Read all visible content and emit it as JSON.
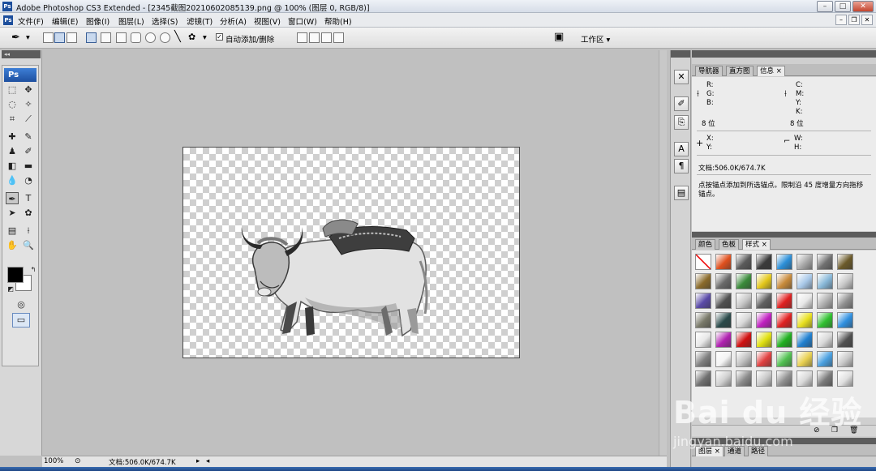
{
  "window": {
    "title": "Adobe Photoshop CS3 Extended - [2345截图20210602085139.png @ 100% (图层 0, RGB/8)]",
    "app_logo": "Ps"
  },
  "menu": [
    "文件(F)",
    "编辑(E)",
    "图像(I)",
    "图层(L)",
    "选择(S)",
    "滤镜(T)",
    "分析(A)",
    "视图(V)",
    "窗口(W)",
    "帮助(H)"
  ],
  "options": {
    "auto_add_delete_label": "自动添加/删除",
    "auto_add_delete_checked": true,
    "workspace_label": "工作区 ▾"
  },
  "tools": {
    "logo": "Ps"
  },
  "status": {
    "zoom": "100%",
    "doc_info": "文档:506.0K/674.7K"
  },
  "info_panel": {
    "tabs": [
      "导航器",
      "直方图",
      "信息"
    ],
    "active_tab": "信息",
    "rgb_labels": [
      "R:",
      "G:",
      "B:"
    ],
    "cmyk_labels": [
      "C:",
      "M:",
      "Y:",
      "K:"
    ],
    "bits_left": "8 位",
    "bits_right": "8 位",
    "xy_labels": [
      "X:",
      "Y:"
    ],
    "wh_labels": [
      "W:",
      "H:"
    ],
    "doc_size": "文档:506.0K/674.7K",
    "hint": "点按锚点添加到所选锚点。限制沿 45 度增量方向拖移锚点。"
  },
  "styles_panel": {
    "tabs": [
      "颜色",
      "色板",
      "样式"
    ],
    "active_tab": "样式",
    "swatch_colors": [
      "#ffffff",
      "#e0501e",
      "#5a5a5a",
      "#3a3a3a",
      "#2b8fd8",
      "#a8a8a8",
      "#707070",
      "#6b5a2a",
      "#8a6a2a",
      "#6a6a6a",
      "#3a8a3a",
      "#e4c81c",
      "#c88a3a",
      "#a8c8e8",
      "#88b8d8",
      "#c8c8c8",
      "#5a4aa8",
      "#505050",
      "#c8c8c8",
      "#606060",
      "#e02020",
      "#e8e8e8",
      "#b0b0b0",
      "#909090",
      "#7a7a6a",
      "#2a4a4a",
      "#d8d8d8",
      "#c020c0",
      "#e02020",
      "#e8e020",
      "#30c030",
      "#3090e0",
      "#e8e8e8",
      "#b020b0",
      "#d01010",
      "#e0e010",
      "#20b020",
      "#2080d0",
      "#d8d8d8",
      "#505050",
      "#808080",
      "#f4f4f4",
      "#c0c0c0",
      "#e04040",
      "#50c050",
      "#e8d050",
      "#4aa0e0",
      "#c8c8c8",
      "#707070",
      "#d0d0d0",
      "#8a8a8a",
      "#c8c8c8",
      "#909090",
      "#d8d8d8",
      "#7a7a7a",
      "#e0e0e0"
    ]
  },
  "layers_panel": {
    "tabs": [
      "图层",
      "通道",
      "路径"
    ],
    "active_tab": "图层"
  },
  "watermark": {
    "brand": "Bai du 经验",
    "url": "jingyan.baidu.com"
  }
}
